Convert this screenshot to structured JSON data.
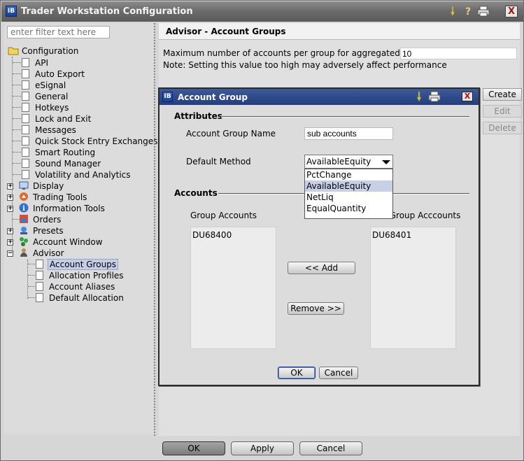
{
  "window": {
    "title": "Trader Workstation Configuration",
    "close": "X",
    "logo": "IB"
  },
  "tree": {
    "filter_placeholder": "enter filter text here",
    "root": "Configuration",
    "items": [
      "API",
      "Auto Export",
      "eSignal",
      "General",
      "Hotkeys",
      "Lock and Exit",
      "Messages",
      "Quick Stock Entry Exchanges",
      "Smart Routing",
      "Sound Manager",
      "Volatility and Analytics"
    ],
    "groups": [
      "Display",
      "Trading Tools",
      "Information Tools",
      "Orders",
      "Presets",
      "Account Window",
      "Advisor"
    ],
    "advisor_children": [
      "Account Groups",
      "Allocation Profiles",
      "Account Aliases",
      "Default Allocation"
    ]
  },
  "panel": {
    "header": "Advisor - Account Groups",
    "max_label": "Maximum number of accounts per group for aggregated P&L",
    "max_value": "10",
    "note": "Note: Setting this value too high may adversely affect performance"
  },
  "side_buttons": {
    "create": "Create",
    "edit": "Edit",
    "delete": "Delete"
  },
  "bottom_buttons": {
    "ok": "OK",
    "apply": "Apply",
    "cancel": "Cancel"
  },
  "dialog": {
    "title": "Account Group",
    "attributes_title": "Attributes",
    "group_name_label": "Account Group Name",
    "group_name_value": "sub accounts",
    "default_method_label": "Default Method",
    "default_method_value": "AvailableEquity",
    "method_options": [
      "PctChange",
      "AvailableEquity",
      "NetLiq",
      "EqualQuantity"
    ],
    "accounts_title": "Accounts",
    "group_accounts_label": "Group Accounts",
    "non_group_accounts_label": "Non Group Acccounts",
    "group_accounts": [
      "DU68400"
    ],
    "non_group_accounts": [
      "DU68401"
    ],
    "add_button": "<< Add",
    "remove_button": "Remove >>",
    "ok_button": "OK",
    "cancel_button": "Cancel"
  }
}
